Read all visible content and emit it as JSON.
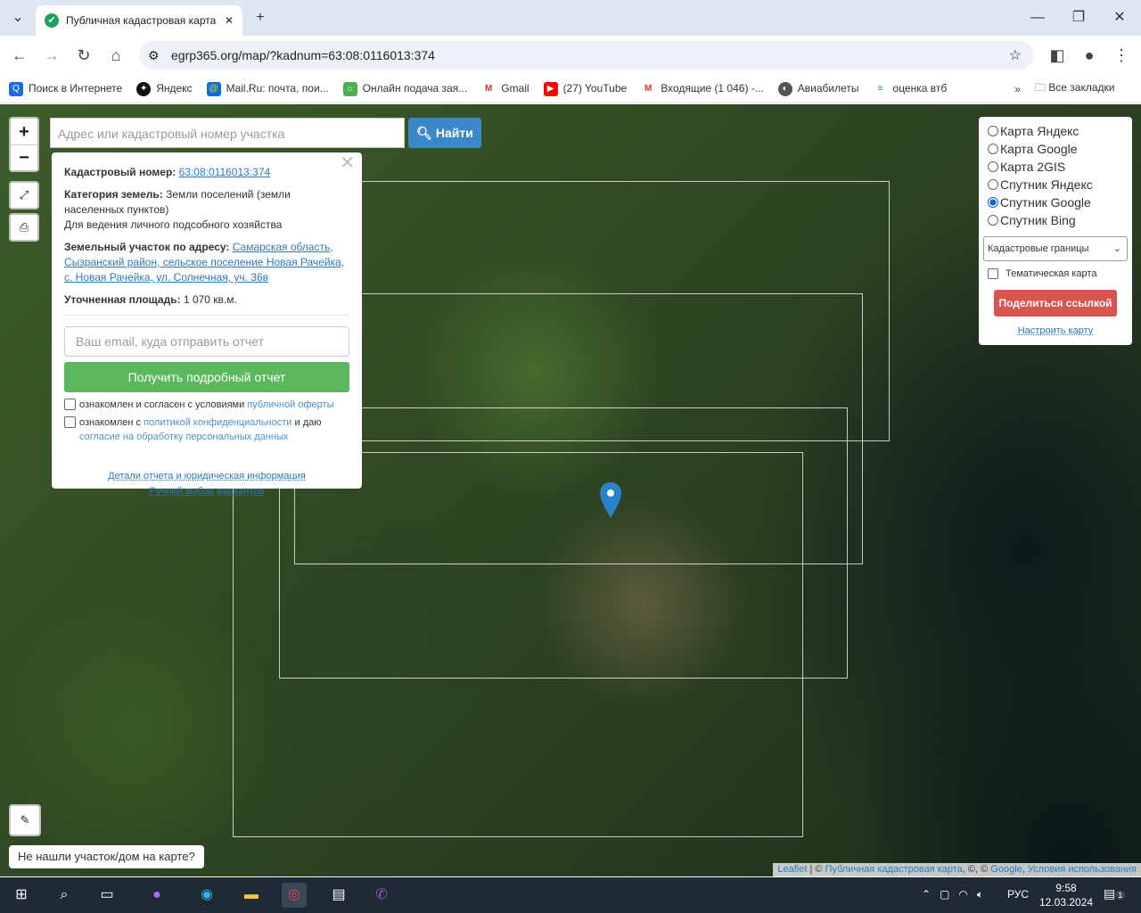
{
  "browser": {
    "tab_title": "Публичная кадастровая карта",
    "url": "egrp365.org/map/?kadnum=63:08:0116013:374",
    "bookmarks": [
      "Поиск в Интернете",
      "Яндекс",
      "Mail.Ru: почта, пои...",
      "Онлайн подача зая...",
      "Gmail",
      "(27) YouTube",
      "Входящие (1 046) -...",
      "Авиабилеты",
      "оценка втб"
    ],
    "all_bookmarks": "Все закладки"
  },
  "map": {
    "search_placeholder": "Адрес или кадастровый номер участка",
    "find_button": "Найти",
    "zoom_in": "+",
    "zoom_out": "−",
    "not_found": "Не нашли участок/дом на карте?",
    "attribution": {
      "leaflet": "Leaflet",
      "rest": " | © ",
      "pkk": "Публичная кадастровая карта",
      "sep": ", ©, © ",
      "google": "Google",
      "comma": ", ",
      "terms": "Условия использования"
    }
  },
  "popup": {
    "kadnum_label": "Кадастровый номер:",
    "kadnum": "63:08:0116013:374",
    "category_label": "Категория земель:",
    "category": "Земли поселений (земли населенных пунктов)",
    "usage": "Для ведения личного подсобного хозяйства",
    "address_label": "Земельный участок по адресу:",
    "address": "Самарская область, Сызранский район, сельское поселение Новая Рачейка, с. Новая Рачейка, ул. Солнечная, уч. 36в",
    "area_label": "Уточненная площадь:",
    "area": "1 070 кв.м.",
    "email_placeholder": "Ваш email, куда отправить отчет",
    "get_report": "Получить подробный отчет",
    "chk1_text": "ознакомлен и согласен с условиями ",
    "chk1_link": "публичной оферты",
    "chk2_text": "ознакомлен с ",
    "chk2_link": "политикой конфиденциальности",
    "chk2_mid": " и даю ",
    "chk2_link2": "согласие на обработку персональных данных",
    "details": "Детали отчета и юридическая информация",
    "manual": "Ручной выбор вариантов"
  },
  "layers": {
    "options": [
      "Карта Яндекс",
      "Карта Google",
      "Карта 2GIS",
      "Спутник Яндекс",
      "Спутник Google",
      "Спутник Bing"
    ],
    "selected": "Спутник Google",
    "overlay": "Кадастровые границы",
    "thematic": "Тематическая карта",
    "share": "Поделиться ссылкой",
    "configure": "Настроить карту"
  },
  "taskbar": {
    "lang": "РУС",
    "time": "9:58",
    "date": "12.03.2024",
    "notifications": "1"
  }
}
